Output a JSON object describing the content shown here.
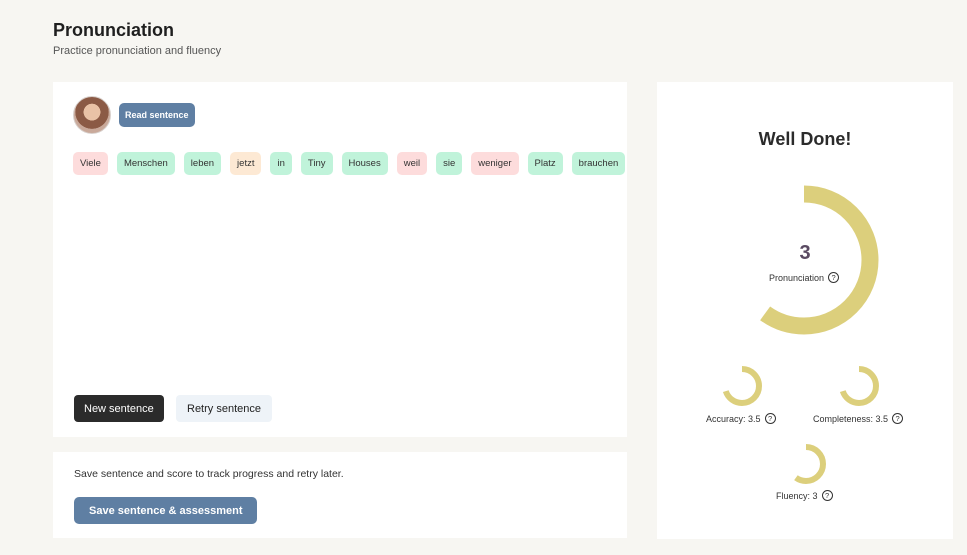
{
  "header": {
    "title": "Pronunciation",
    "subtitle": "Practice pronunciation and fluency"
  },
  "practice": {
    "read_button": "Read sentence",
    "words": [
      {
        "text": "Viele",
        "status": "red"
      },
      {
        "text": "Menschen",
        "status": "green"
      },
      {
        "text": "leben",
        "status": "green"
      },
      {
        "text": "jetzt",
        "status": "orange"
      },
      {
        "text": "in",
        "status": "green"
      },
      {
        "text": "Tiny",
        "status": "green"
      },
      {
        "text": "Houses",
        "status": "green"
      },
      {
        "text": "weil",
        "status": "red"
      },
      {
        "text": "sie",
        "status": "green"
      },
      {
        "text": "weniger",
        "status": "red"
      },
      {
        "text": "Platz",
        "status": "green"
      },
      {
        "text": "brauchen",
        "status": "green"
      }
    ],
    "new_button": "New sentence",
    "retry_button": "Retry sentence"
  },
  "save": {
    "text": "Save sentence and score to track progress and retry later.",
    "button": "Save sentence & assessment"
  },
  "score": {
    "heading": "Well Done!",
    "ring_color": "#dccf7c",
    "pronunciation": {
      "value": "3",
      "label": "Pronunciation",
      "fraction": 0.6
    },
    "accuracy": {
      "label": "Accuracy: 3.5",
      "fraction": 0.7
    },
    "completeness": {
      "label": "Completeness: 3.5",
      "fraction": 0.7
    },
    "fluency": {
      "label": "Fluency: 3",
      "fraction": 0.6
    }
  },
  "colors": {
    "primary_button": "#5f7fa3",
    "word_red": "#fddcdc",
    "word_green": "#c0f3da",
    "word_orange": "#fde9d4"
  }
}
